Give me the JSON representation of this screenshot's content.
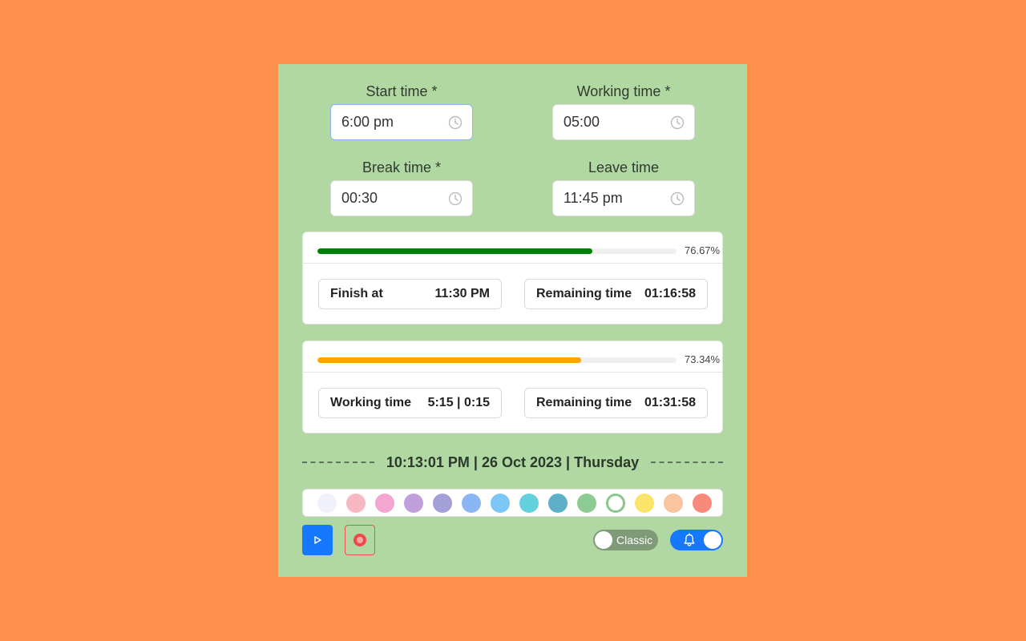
{
  "form": {
    "start_time": {
      "label": "Start time *",
      "value": "6:00 pm",
      "icon": "clock-icon"
    },
    "working_time": {
      "label": "Working time *",
      "value": "05:00",
      "icon": "clock-icon"
    },
    "break_time": {
      "label": "Break time *",
      "value": "00:30",
      "icon": "clock-icon"
    },
    "leave_time": {
      "label": "Leave time",
      "value": "11:45 pm",
      "icon": "clock-icon"
    }
  },
  "work_progress": {
    "percent": 76.67,
    "percent_label": "76.67%",
    "color": "#008000",
    "finish_label": "Finish at",
    "finish_value": "11:30 PM",
    "remaining_label": "Remaining time",
    "remaining_value": "01:16:58"
  },
  "leave_progress": {
    "percent": 73.34,
    "percent_label": "73.34%",
    "color": "#FFA500",
    "working_label": "Working time",
    "working_value": "5:15 | 0:15",
    "remaining_label": "Remaining time",
    "remaining_value": "01:31:58"
  },
  "datetime": "10:13:01 PM | 26 Oct 2023 | Thursday",
  "theme_colors": [
    "#F1F1FB",
    "#F7B8C2",
    "#F3A6CF",
    "#C0A0DC",
    "#A3A0D8",
    "#8AB6F4",
    "#7CC7F5",
    "#63D1DD",
    "#5EB0C8",
    "#8CCB93",
    "#FFFFFF",
    "#FAE46A",
    "#F9C49E",
    "#F78A7A"
  ],
  "selected_theme_index": 10,
  "controls": {
    "play_icon": "play-icon",
    "record_icon": "record-icon",
    "classic_toggle_label": "Classic",
    "classic_toggle_on": false,
    "notification_toggle_on": true,
    "notification_icon": "bell-icon"
  },
  "colors": {
    "page_background": "#FF914D",
    "panel_background": "#B1D8A2",
    "primary": "#1677FF"
  }
}
